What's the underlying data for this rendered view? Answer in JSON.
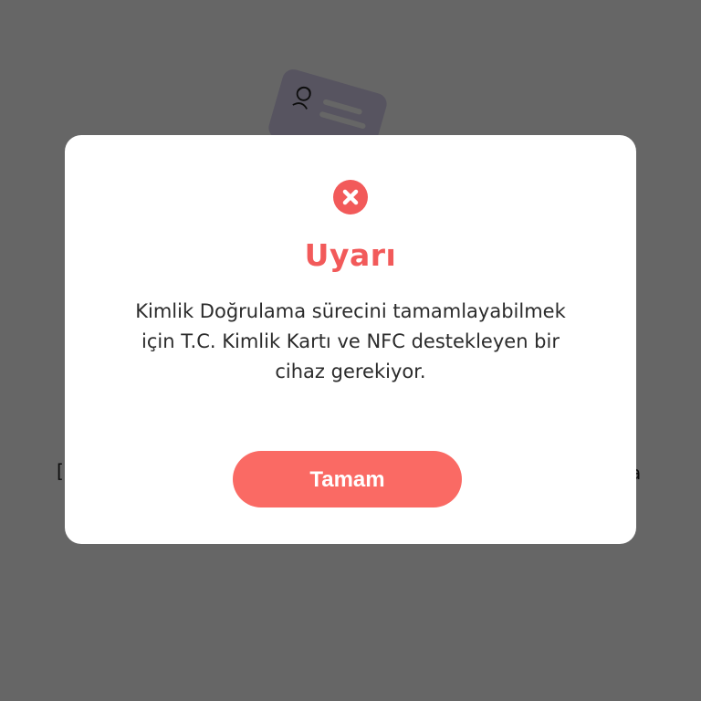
{
  "background": {
    "left_text": "[",
    "right_text": "a"
  },
  "dialog": {
    "icon": "error-x-icon",
    "title": "Uyarı",
    "message": "Kimlik Doğrulama sürecini tamamlayabilmek için T.C. Kimlik Kartı ve NFC destekleyen bir cihaz gerekiyor.",
    "button_label": "Tamam"
  },
  "colors": {
    "accent": "#f25a5a",
    "button": "#fa6a64",
    "overlay": "rgba(0,0,0,0.6)",
    "card": "#d9d2ef"
  }
}
